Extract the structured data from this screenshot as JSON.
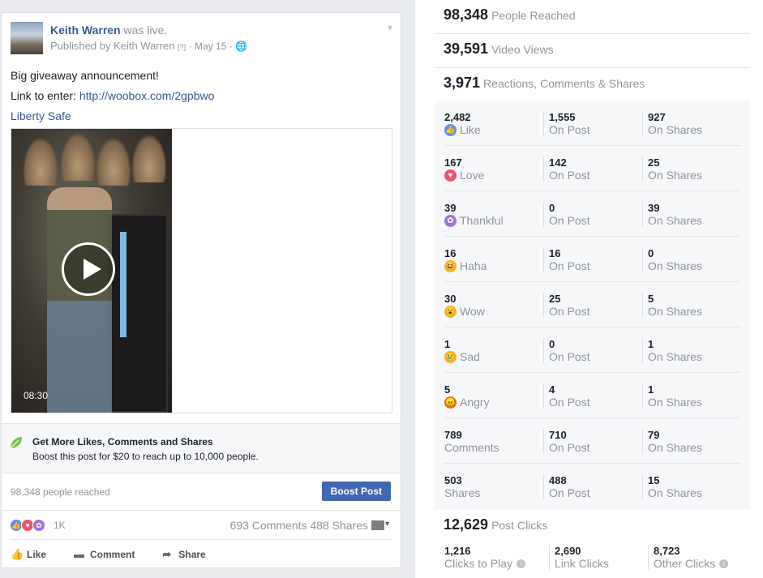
{
  "post": {
    "author": "Keith Warren",
    "action": "was live.",
    "published_by": "Published by Keith Warren",
    "q_mark": "[?]",
    "date": "May 15",
    "text_line1": "Big giveaway announcement!",
    "text_line2_prefix": "Link to enter: ",
    "text_link": "http://woobox.com/2gpbwo",
    "page_link": "Liberty Safe",
    "video_duration": "08:30",
    "boost_title": "Get More Likes, Comments and Shares",
    "boost_sub": "Boost this post for $20 to reach up to 10,000 people.",
    "reached": "98,348 people reached",
    "boost_button": "Boost Post",
    "reaction_count": "1K",
    "comments_shares": "693 Comments  488 Shares",
    "actions": {
      "like": "Like",
      "comment": "Comment",
      "share": "Share"
    }
  },
  "insights": {
    "people_reached": {
      "value": "98,348",
      "label": "People Reached"
    },
    "video_views": {
      "value": "39,591",
      "label": "Video Views"
    },
    "engagement": {
      "value": "3,971",
      "label": "Reactions, Comments & Shares"
    },
    "rows": [
      {
        "total": "2,482",
        "label": "Like",
        "on_post": "1,555",
        "on_shares": "927",
        "emoji": "like-icon",
        "color": "#5890ff",
        "glyph": "👍"
      },
      {
        "total": "167",
        "label": "Love",
        "on_post": "142",
        "on_shares": "25",
        "emoji": "love-icon",
        "color": "#f25268",
        "glyph": "♥"
      },
      {
        "total": "39",
        "label": "Thankful",
        "on_post": "0",
        "on_shares": "39",
        "emoji": "thankful-icon",
        "color": "#9b74d9",
        "glyph": "✿"
      },
      {
        "total": "16",
        "label": "Haha",
        "on_post": "16",
        "on_shares": "0",
        "emoji": "haha-icon",
        "color": "#f7b125",
        "glyph": "😆"
      },
      {
        "total": "30",
        "label": "Wow",
        "on_post": "25",
        "on_shares": "5",
        "emoji": "wow-icon",
        "color": "#f7b125",
        "glyph": "😮"
      },
      {
        "total": "1",
        "label": "Sad",
        "on_post": "0",
        "on_shares": "1",
        "emoji": "sad-icon",
        "color": "#f7b125",
        "glyph": "😢"
      },
      {
        "total": "5",
        "label": "Angry",
        "on_post": "4",
        "on_shares": "1",
        "emoji": "angry-icon",
        "color": "#e9710f",
        "glyph": "😠"
      },
      {
        "total": "789",
        "label": "Comments",
        "on_post": "710",
        "on_shares": "79",
        "emoji": "",
        "color": "",
        "glyph": ""
      },
      {
        "total": "503",
        "label": "Shares",
        "on_post": "488",
        "on_shares": "15",
        "emoji": "",
        "color": "",
        "glyph": ""
      }
    ],
    "on_post_label": "On Post",
    "on_shares_label": "On Shares",
    "post_clicks": {
      "value": "12,629",
      "label": "Post Clicks"
    },
    "clicks": [
      {
        "value": "1,216",
        "label": "Clicks to Play",
        "info": true
      },
      {
        "value": "2,690",
        "label": "Link Clicks",
        "info": false
      },
      {
        "value": "8,723",
        "label": "Other Clicks",
        "info": true
      }
    ]
  }
}
